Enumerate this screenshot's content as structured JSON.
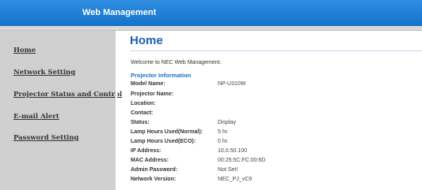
{
  "header": {
    "title": "Web Management"
  },
  "sidebar": {
    "items": [
      {
        "label": "Home"
      },
      {
        "label": "Network Setting"
      },
      {
        "label": "Projector Status and Control"
      },
      {
        "label": "E-mail Alert"
      },
      {
        "label": "Password Setting"
      }
    ]
  },
  "main": {
    "title": "Home",
    "welcome": "Welcome to NEC Web Management.",
    "section_title": "Projector Information",
    "rows": [
      {
        "label": "Model Name:",
        "value": "NP-U310W"
      },
      {
        "label": "Projector Name:",
        "value": ""
      },
      {
        "label": "Location:",
        "value": ""
      },
      {
        "label": "Contact:",
        "value": ""
      },
      {
        "label": "Status:",
        "value": "Display"
      },
      {
        "label": "Lamp Hours Used(Normal):",
        "value": "5 hr."
      },
      {
        "label": "Lamp Hours Used(ECO):",
        "value": "0 hr."
      },
      {
        "label": "IP Address:",
        "value": "10.0.50.100"
      },
      {
        "label": "MAC Address:",
        "value": "00:25:5C:FC:00:6D"
      },
      {
        "label": "Admin Password:",
        "value": "Not Set!"
      },
      {
        "label": "Network Version:",
        "value": "NEC_PJ_vC9"
      }
    ]
  }
}
